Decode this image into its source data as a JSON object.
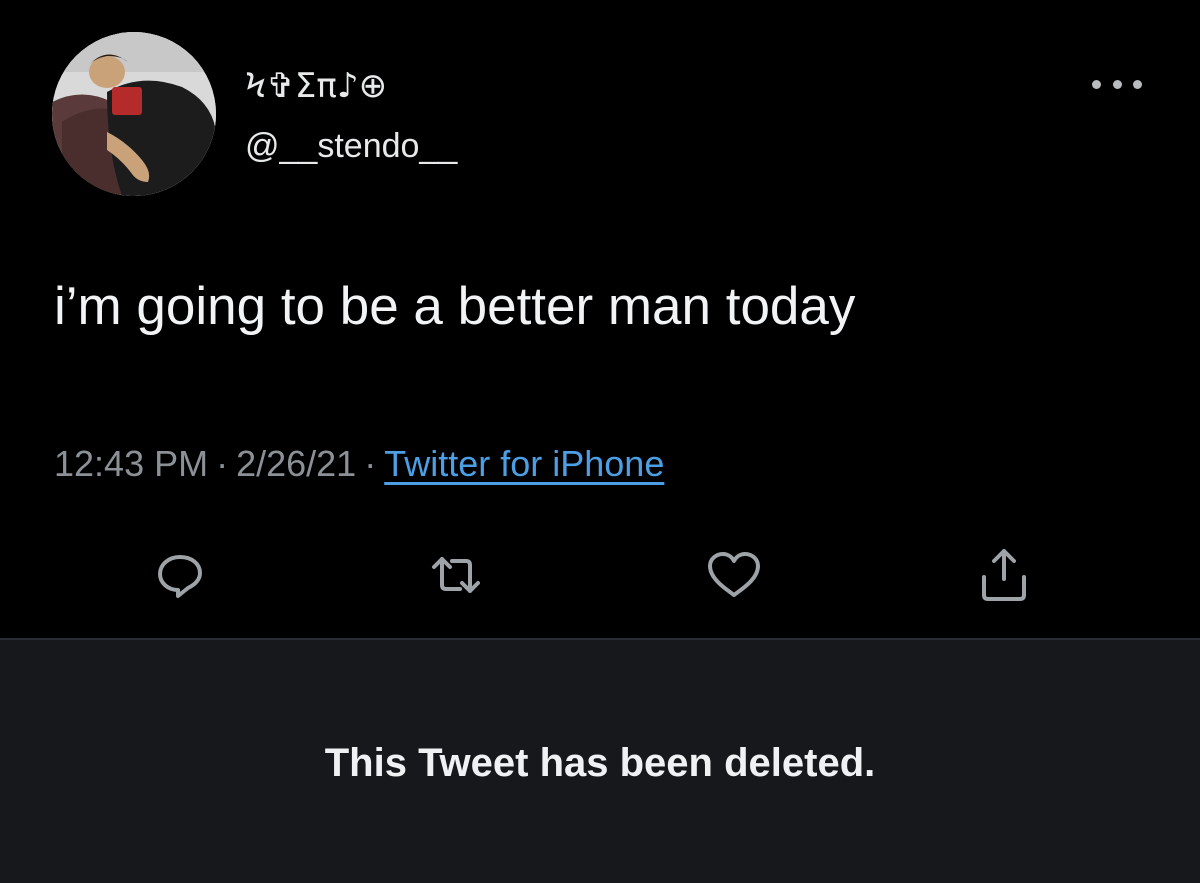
{
  "author": {
    "display_name": "Ϟ✞Σπ♪⊕",
    "handle": "@__stendo__"
  },
  "tweet": {
    "text": "i’m going to be a better man today",
    "time": "12:43 PM",
    "date": "2/26/21",
    "separator": "·",
    "source": "Twitter for iPhone"
  },
  "actions": [
    {
      "name": "reply",
      "icon": "reply-icon"
    },
    {
      "name": "retweet",
      "icon": "retweet-icon"
    },
    {
      "name": "like",
      "icon": "heart-icon"
    },
    {
      "name": "share",
      "icon": "share-icon"
    }
  ],
  "deleted_notice": {
    "text": "This Tweet has been deleted."
  },
  "colors": {
    "background": "#000000",
    "text": "#e7e9ea",
    "secondary_text": "#8b9196",
    "link": "#4c9fe4",
    "icon": "#9ea3a8",
    "deleted_panel": "#16181c"
  }
}
